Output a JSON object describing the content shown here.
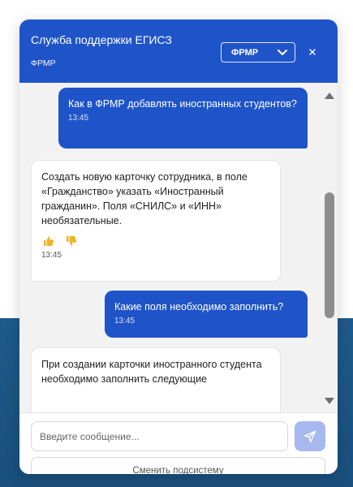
{
  "header": {
    "title": "Служба поддержки ЕГИСЗ",
    "subtitle": "ФРМР",
    "subsystem_select": {
      "selected": "ФРМР"
    },
    "close_label": "×"
  },
  "messages": [
    {
      "role": "user",
      "text": "Как в ФРМР добавлять иностранных студентов?",
      "time": "13:45"
    },
    {
      "role": "bot",
      "text": "Создать новую карточку сотрудника, в поле «Гражданство» указать «Иностранный гражданин». Поля «СНИЛС» и «ИНН» необязательные.",
      "time": "13:45",
      "feedback": [
        "thumbs-up",
        "thumbs-down"
      ]
    },
    {
      "role": "user",
      "text": "Какие поля необходимо заполнить?",
      "time": "13:45"
    },
    {
      "role": "bot",
      "text": "При создании карточки иностранного студента необходимо заполнить следующие"
    }
  ],
  "composer": {
    "placeholder": "Введите сообщение...",
    "switch_label": "Сменить подсистему"
  },
  "colors": {
    "accent": "#1f54c9",
    "send_disabled": "#a7b8ee",
    "thumb_icon": "#f0b429",
    "page_bottom": "#1e5a8a"
  }
}
